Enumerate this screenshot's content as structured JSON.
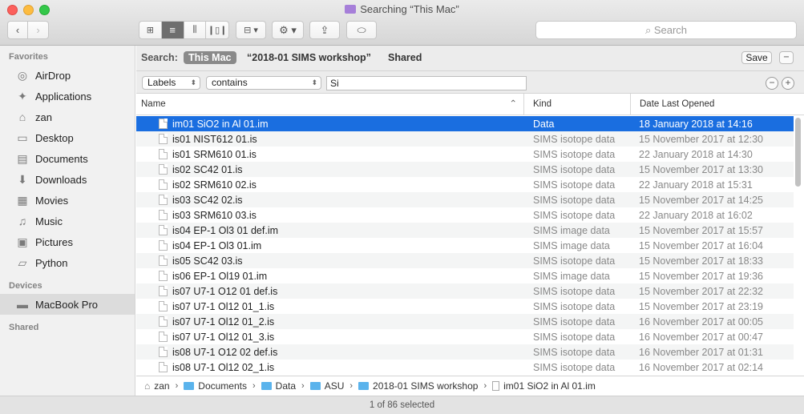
{
  "window": {
    "title": "Searching “This Mac”"
  },
  "toolbar": {
    "search_placeholder": "Search",
    "view_icons": [
      "icon-view-icon",
      "list-view-icon",
      "column-view-icon",
      "cover-flow-icon"
    ],
    "group_icon": "arrange-icon",
    "action_icon": "gear-icon",
    "share_icon": "share-icon",
    "tag_icon": "tag-icon"
  },
  "sidebar": {
    "favorites_header": "Favorites",
    "favorites": [
      {
        "label": "AirDrop",
        "icon": "airdrop-icon",
        "glyph": "◎"
      },
      {
        "label": "Applications",
        "icon": "applications-icon",
        "glyph": "✦"
      },
      {
        "label": "zan",
        "icon": "home-icon",
        "glyph": "⌂"
      },
      {
        "label": "Desktop",
        "icon": "desktop-icon",
        "glyph": "▭"
      },
      {
        "label": "Documents",
        "icon": "documents-icon",
        "glyph": "▤"
      },
      {
        "label": "Downloads",
        "icon": "downloads-icon",
        "glyph": "⬇"
      },
      {
        "label": "Movies",
        "icon": "movies-icon",
        "glyph": "▦"
      },
      {
        "label": "Music",
        "icon": "music-icon",
        "glyph": "♫"
      },
      {
        "label": "Pictures",
        "icon": "pictures-icon",
        "glyph": "▣"
      },
      {
        "label": "Python",
        "icon": "folder-icon",
        "glyph": "▱"
      }
    ],
    "devices_header": "Devices",
    "devices": [
      {
        "label": "MacBook Pro",
        "icon": "laptop-icon",
        "glyph": "▬"
      }
    ],
    "shared_header": "Shared"
  },
  "scope": {
    "label": "Search:",
    "this_mac": "This Mac",
    "folder": "“2018-01 SIMS workshop”",
    "shared": "Shared",
    "save": "Save",
    "remove": "−"
  },
  "criteria": {
    "attribute": "Labels",
    "operator": "contains",
    "value": "Si",
    "minus": "−",
    "plus": "+"
  },
  "columns": {
    "name": "Name",
    "kind": "Kind",
    "date": "Date Last Opened"
  },
  "files": [
    {
      "name": "im01 SiO2 in Al 01.im",
      "kind": "Data",
      "date": "18 January 2018 at 14:16",
      "selected": true
    },
    {
      "name": "is01 NIST612 01.is",
      "kind": "SIMS isotope data",
      "date": "15 November 2017 at 12:30"
    },
    {
      "name": "is01 SRM610 01.is",
      "kind": "SIMS isotope data",
      "date": "22 January 2018 at 14:30"
    },
    {
      "name": "is02 SC42 01.is",
      "kind": "SIMS isotope data",
      "date": "15 November 2017 at 13:30"
    },
    {
      "name": "is02 SRM610 02.is",
      "kind": "SIMS isotope data",
      "date": "22 January 2018 at 15:31"
    },
    {
      "name": "is03 SC42 02.is",
      "kind": "SIMS isotope data",
      "date": "15 November 2017 at 14:25"
    },
    {
      "name": "is03 SRM610 03.is",
      "kind": "SIMS isotope data",
      "date": "22 January 2018 at 16:02"
    },
    {
      "name": "is04 EP-1 Ol3 01 def.im",
      "kind": "SIMS image data",
      "date": "15 November 2017 at 15:57"
    },
    {
      "name": "is04 EP-1 Ol3 01.im",
      "kind": "SIMS image data",
      "date": "15 November 2017 at 16:04"
    },
    {
      "name": "is05 SC42 03.is",
      "kind": "SIMS isotope data",
      "date": "15 November 2017 at 18:33"
    },
    {
      "name": "is06 EP-1 Ol19 01.im",
      "kind": "SIMS image data",
      "date": "15 November 2017 at 19:36"
    },
    {
      "name": "is07 U7-1 O12 01 def.is",
      "kind": "SIMS isotope data",
      "date": "15 November 2017 at 22:32"
    },
    {
      "name": "is07 U7-1 Ol12 01_1.is",
      "kind": "SIMS isotope data",
      "date": "15 November 2017 at 23:19"
    },
    {
      "name": "is07 U7-1 Ol12 01_2.is",
      "kind": "SIMS isotope data",
      "date": "16 November 2017 at 00:05"
    },
    {
      "name": "is07 U7-1 Ol12 01_3.is",
      "kind": "SIMS isotope data",
      "date": "16 November 2017 at 00:47"
    },
    {
      "name": "is08 U7-1 O12 02 def.is",
      "kind": "SIMS isotope data",
      "date": "16 November 2017 at 01:31"
    },
    {
      "name": "is08 U7-1 Ol12 02_1.is",
      "kind": "SIMS isotope data",
      "date": "16 November 2017 at 02:14"
    }
  ],
  "path": [
    {
      "label": "zan",
      "type": "home"
    },
    {
      "label": "Documents",
      "type": "folder"
    },
    {
      "label": "Data",
      "type": "folder"
    },
    {
      "label": "ASU",
      "type": "folder"
    },
    {
      "label": "2018-01 SIMS workshop",
      "type": "folder"
    },
    {
      "label": "im01 SiO2 in Al 01.im",
      "type": "file"
    }
  ],
  "status": "1 of 86 selected",
  "colors": {
    "selection": "#1a6ee0",
    "sidebar_bg": "#f1f1f1",
    "folder": "#5ab3ec"
  }
}
